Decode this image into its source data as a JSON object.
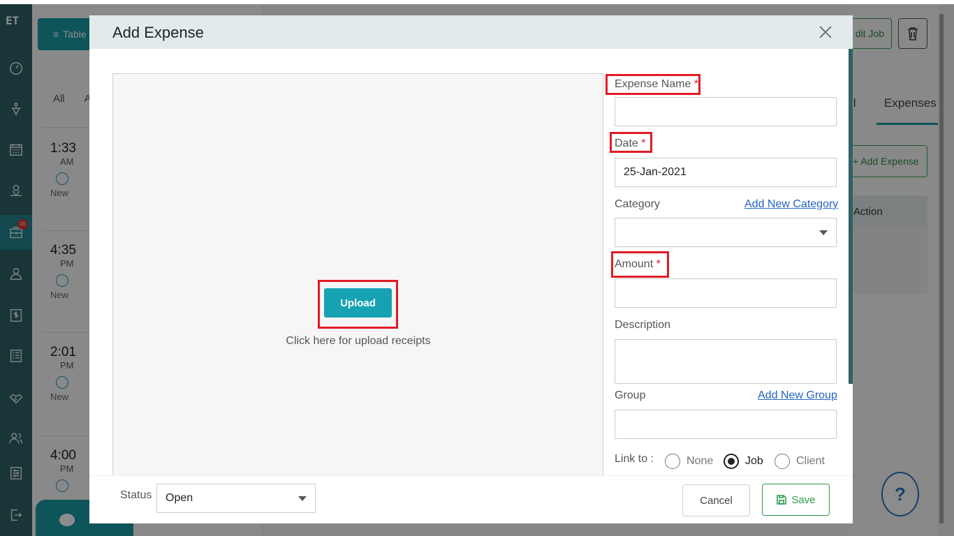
{
  "sidebar": {
    "logo": "ET",
    "badge_count": "20",
    "icons": [
      "dashboard-icon",
      "dispatch-icon",
      "calendar-icon",
      "map-icon",
      "jobs-icon",
      "client-icon",
      "invoice-icon",
      "list-icon",
      "handshake-icon",
      "team-icon",
      "settings-icon",
      "logout-icon"
    ]
  },
  "background": {
    "table_button": "Table",
    "tabs": [
      "All",
      "A"
    ],
    "slots": [
      {
        "time": "1:33",
        "ampm": "AM",
        "status": "New"
      },
      {
        "time": "4:35",
        "ampm": "PM",
        "status": "New"
      },
      {
        "time": "2:01",
        "ampm": "PM",
        "status": "New"
      },
      {
        "time": "4:00",
        "ampm": "PM"
      }
    ],
    "edit_job": "dit Job",
    "detail_tab": "il",
    "expenses_tab": "Expenses",
    "add_expense": "+ Add Expense",
    "action_header": "Action",
    "help": "?"
  },
  "modal": {
    "title": "Add Expense",
    "upload_button": "Upload",
    "upload_hint": "Click here for upload receipts",
    "fields": {
      "expense_name_label": "Expense Name",
      "required_mark": "*",
      "date_label": "Date",
      "date_value": "25-Jan-2021",
      "category_label": "Category",
      "add_category": "Add New Category",
      "amount_label": "Amount",
      "description_label": "Description",
      "group_label": "Group",
      "add_group": "Add New Group",
      "link_to_label": "Link to :",
      "link_options": [
        "None",
        "Job",
        "Client"
      ],
      "link_selected": "Job"
    },
    "footer": {
      "status_label": "Status",
      "status_value": "Open",
      "cancel": "Cancel",
      "save": "Save"
    }
  },
  "colors": {
    "sidebar": "#2e6166",
    "accent": "#17a2b3",
    "highlight": "#e01b24",
    "save_green": "#2a9a48",
    "link": "#2563c8"
  }
}
